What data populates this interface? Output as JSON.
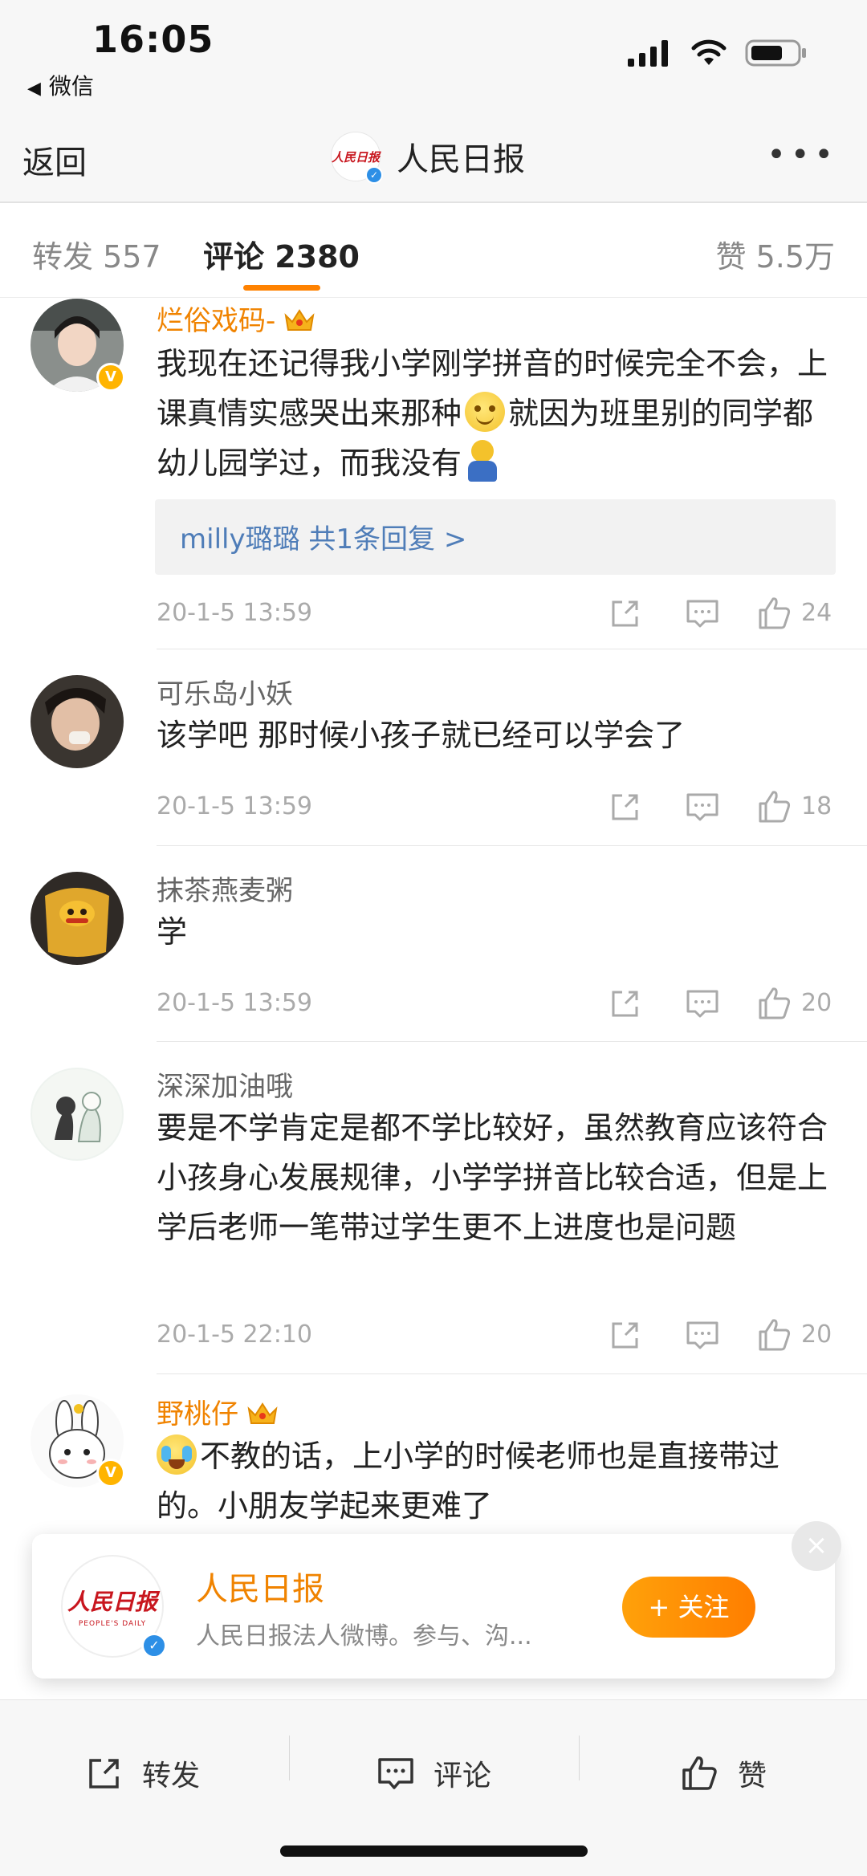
{
  "status_bar": {
    "time": "16:05",
    "back_app": "微信"
  },
  "nav": {
    "back": "返回",
    "title": "人民日报",
    "logo_text": "人民日报",
    "more": "•••"
  },
  "tabs": {
    "repost": "转发 557",
    "comment": "评论 2380",
    "like": "赞 5.5万"
  },
  "comments": [
    {
      "username": "烂俗戏码-",
      "text_parts": [
        "我现在还记得我小学刚学拼音的时候完全不会，上课真情实感哭出来那种",
        "就因为班里别的同学都幼儿园学过，而我没有"
      ],
      "reply_summary": "milly璐璐  共1条回复 >",
      "date": "20-1-5 13:59",
      "likes": "24"
    },
    {
      "username": "可乐岛小妖",
      "text": "该学吧 那时候小孩子就已经可以学会了",
      "date": "20-1-5 13:59",
      "likes": "18"
    },
    {
      "username": "抹茶燕麦粥",
      "text": "学",
      "date": "20-1-5 13:59",
      "likes": "20"
    },
    {
      "username": "深深加油哦",
      "text": "要是不学肯定是都不学比较好，虽然教育应该符合小孩身心发展规律，小学学拼音比较合适，但是上学后老师一笔带过学生更不上进度也是问题",
      "date": "20-1-5 22:10",
      "likes": "20"
    },
    {
      "username": "野桃仔",
      "text": "不教的话，上小学的时候老师也是直接带过的。小朋友学起来更难了"
    }
  ],
  "follow_card": {
    "logo_cn": "人民日报",
    "logo_en": "PEOPLE'S DAILY",
    "name": "人民日报",
    "description": "人民日报法人微博。参与、沟...",
    "button": "+ 关注",
    "close": "×"
  },
  "toolbar": {
    "repost": "转发",
    "comment": "评论",
    "like": "赞"
  },
  "colors": {
    "accent": "#ff8200",
    "vip_name": "#f08300",
    "link": "#4f7db8",
    "verified_blue": "#2d8fe6"
  }
}
